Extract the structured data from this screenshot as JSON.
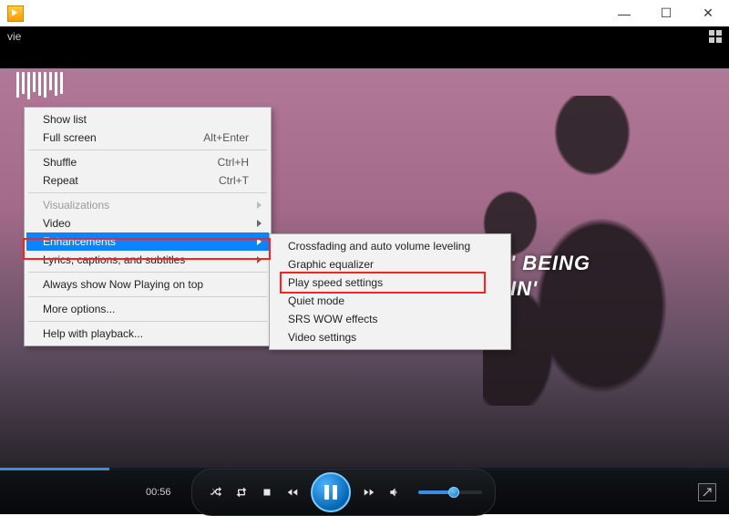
{
  "window": {
    "minimize": "—",
    "maximize": "☐",
    "close": "✕"
  },
  "menubar": {
    "label": "vie"
  },
  "overlay": {
    "line1": "' BEING",
    "line2": "IN'"
  },
  "context_menu": {
    "items": [
      {
        "label": "Show list",
        "shortcut": "",
        "submenu": false,
        "disabled": false
      },
      {
        "label": "Full screen",
        "shortcut": "Alt+Enter",
        "submenu": false,
        "disabled": false
      },
      null,
      {
        "label": "Shuffle",
        "shortcut": "Ctrl+H",
        "submenu": false,
        "disabled": false
      },
      {
        "label": "Repeat",
        "shortcut": "Ctrl+T",
        "submenu": false,
        "disabled": false
      },
      null,
      {
        "label": "Visualizations",
        "shortcut": "",
        "submenu": true,
        "disabled": true
      },
      {
        "label": "Video",
        "shortcut": "",
        "submenu": true,
        "disabled": false
      },
      {
        "label": "Enhancements",
        "shortcut": "",
        "submenu": true,
        "disabled": false
      },
      {
        "label": "Lyrics, captions, and subtitles",
        "shortcut": "",
        "submenu": true,
        "disabled": false
      },
      null,
      {
        "label": "Always show Now Playing on top",
        "shortcut": "",
        "submenu": false,
        "disabled": false
      },
      null,
      {
        "label": "More options...",
        "shortcut": "",
        "submenu": false,
        "disabled": false
      },
      null,
      {
        "label": "Help with playback...",
        "shortcut": "",
        "submenu": false,
        "disabled": false
      }
    ],
    "highlight_index": 8,
    "submenu": {
      "items": [
        {
          "label": "Crossfading and auto volume leveling"
        },
        {
          "label": "Graphic equalizer"
        },
        {
          "label": "Play speed settings"
        },
        {
          "label": "Quiet mode"
        },
        {
          "label": "SRS WOW effects"
        },
        {
          "label": "Video settings"
        }
      ],
      "highlight_index": 2
    }
  },
  "playback": {
    "elapsed": "00:56",
    "progress_percent": 15,
    "volume_percent": 55
  }
}
